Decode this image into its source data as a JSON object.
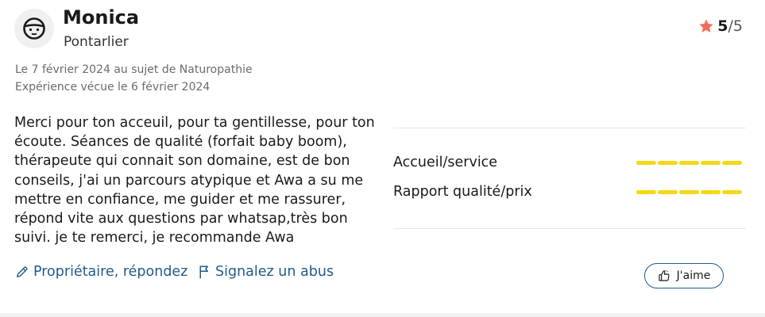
{
  "reviewer": {
    "name": "Monica",
    "city": "Pontarlier",
    "avatar_icon": "face-avatar-icon"
  },
  "rating": {
    "score": "5",
    "max": "/5",
    "star_color": "#f36c5a"
  },
  "meta": {
    "line1": "Le 7 février 2024 au sujet de Naturopathie",
    "line2": "Expérience vécue le 6 février 2024"
  },
  "review_text": "Merci pour ton acceuil, pour ta gentillesse, pour ton écoute. Séances de qualité (forfait baby boom), thérapeute qui connait son domaine, est de bon conseils, j'ai un parcours atypique et Awa a su me mettre en confiance, me guider et me rassurer, répond vite aux questions par whatsap,très bon suivi. je te remerci, je recommande Awa",
  "criteria": [
    {
      "label": "Accueil/service",
      "score": 5,
      "max": 5
    },
    {
      "label": "Rapport qualité/prix",
      "score": 5,
      "max": 5
    }
  ],
  "actions": {
    "reply_label": "Propriétaire, répondez",
    "report_label": "Signalez un abus",
    "like_label": "J'aime"
  },
  "colors": {
    "link": "#1f5c8a",
    "bar": "#f5d816"
  }
}
